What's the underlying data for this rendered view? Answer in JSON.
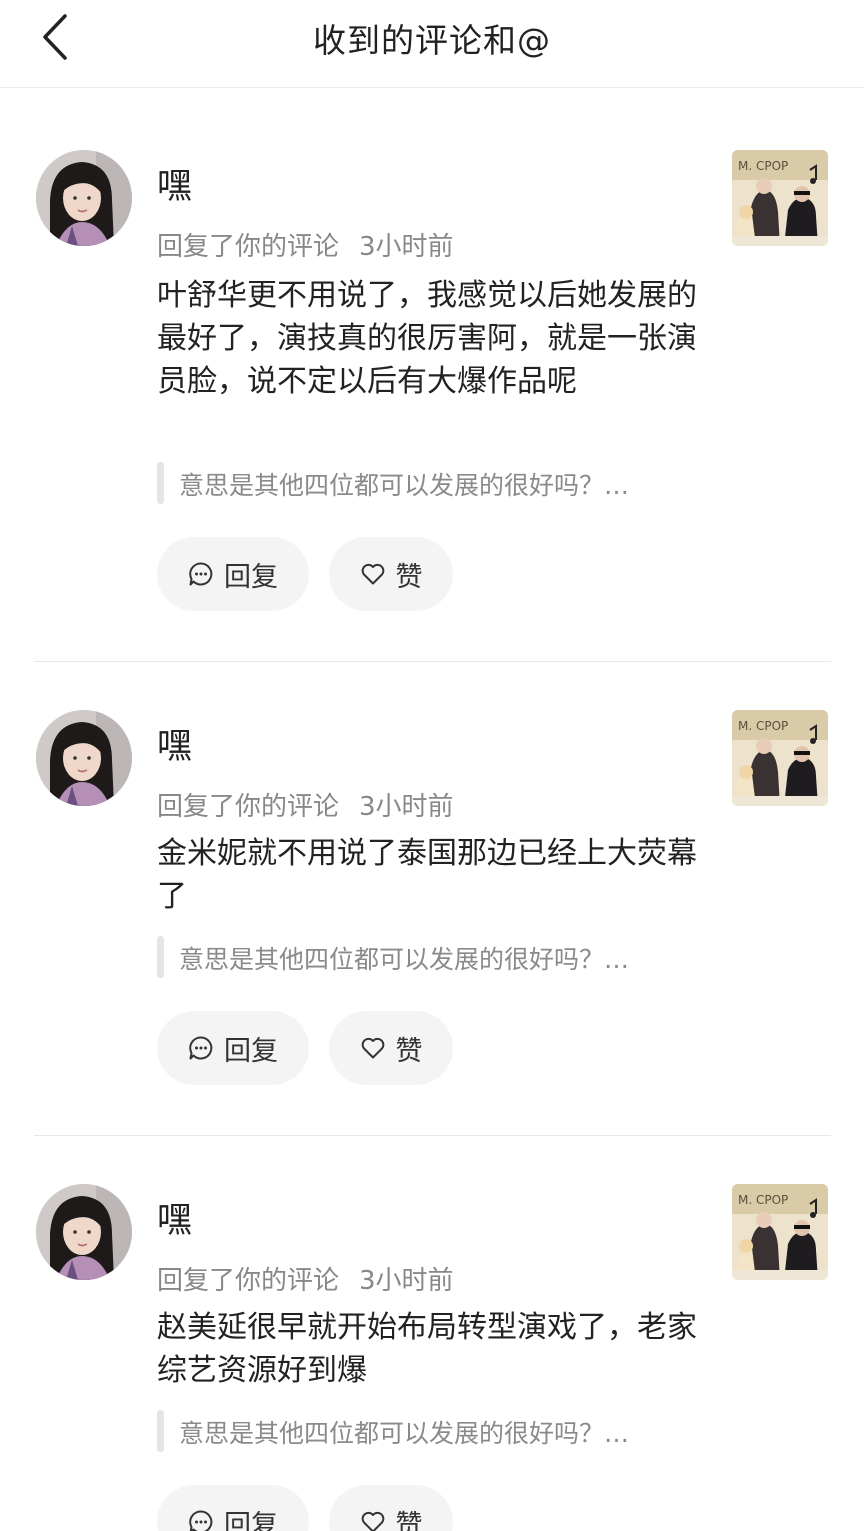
{
  "header": {
    "title": "收到的评论和@"
  },
  "actions": {
    "reply": "回复",
    "like": "赞"
  },
  "comments": [
    {
      "user": "嘿",
      "action": "回复了你的评论",
      "time": "3小时前",
      "text": "叶舒华更不用说了，我感觉以后她发展的最好了，演技真的很厉害阿，就是一张演员脸，说不定以后有大爆作品呢",
      "quote": "意思是其他四位都可以发展的很好吗？…"
    },
    {
      "user": "嘿",
      "action": "回复了你的评论",
      "time": "3小时前",
      "text": "金米妮就不用说了泰国那边已经上大荧幕了",
      "quote": "意思是其他四位都可以发展的很好吗？…"
    },
    {
      "user": "嘿",
      "action": "回复了你的评论",
      "time": "3小时前",
      "text": "赵美延很早就开始布局转型演戏了，老家综艺资源好到爆",
      "quote": "意思是其他四位都可以发展的很好吗？…"
    }
  ]
}
